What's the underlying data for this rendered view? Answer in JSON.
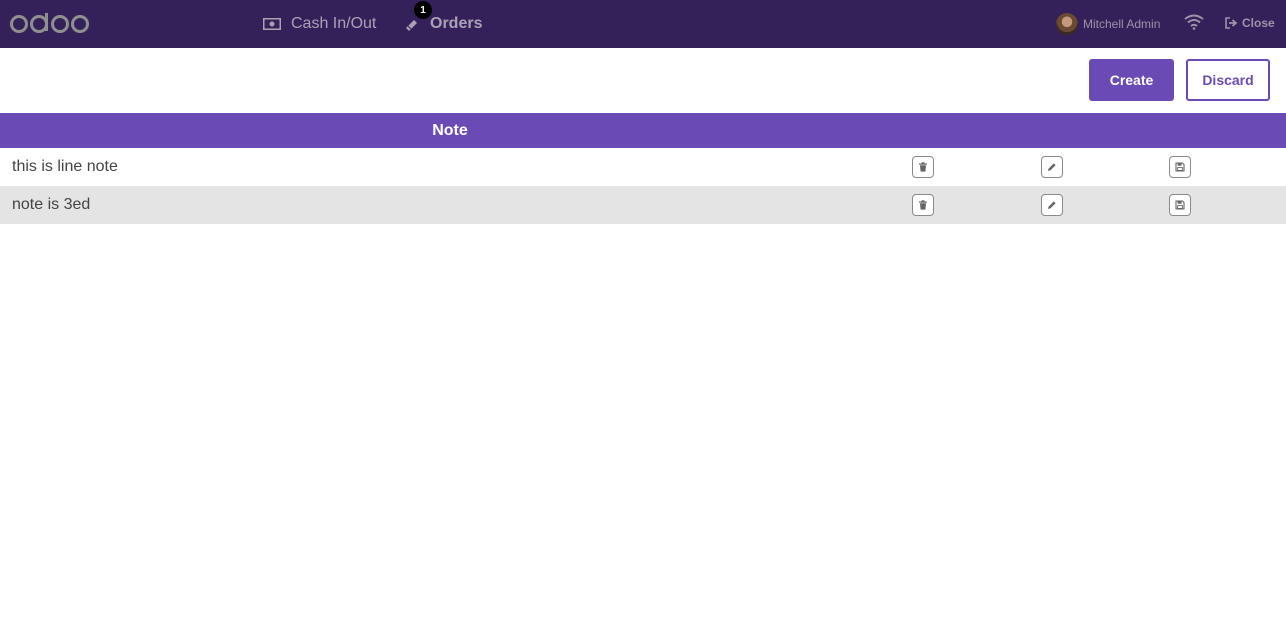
{
  "app": {
    "logo_text": "odoo"
  },
  "topbar": {
    "cash_label": "Cash In/Out",
    "orders_label": "Orders",
    "orders_badge": "1",
    "user_name": "Mitchell Admin",
    "close_label": "Close"
  },
  "actions": {
    "create_label": "Create",
    "discard_label": "Discard"
  },
  "table": {
    "columns": [
      "Note"
    ],
    "rows": [
      {
        "note": "this is line note"
      },
      {
        "note": "note is 3ed"
      }
    ]
  },
  "colors": {
    "topbar_bg": "#35215a",
    "accent": "#6a4bb5",
    "alt_row": "#e4e4e4"
  },
  "icons": [
    "cash-icon",
    "orders-icon",
    "avatar",
    "wifi-icon",
    "sign-out-icon",
    "trash-icon",
    "pencil-icon",
    "save-icon"
  ]
}
